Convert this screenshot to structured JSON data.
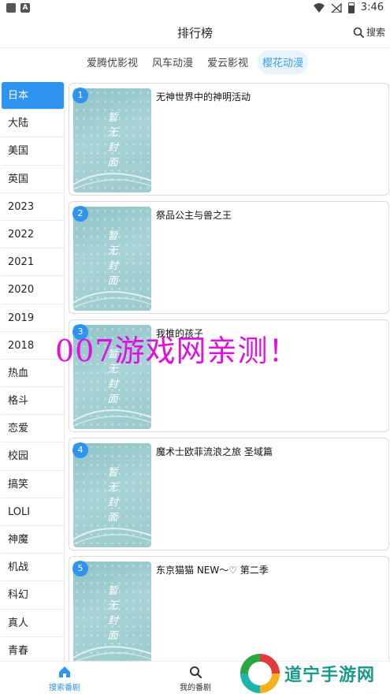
{
  "status_bar": {
    "time": "3:46",
    "left_badge": "A"
  },
  "header": {
    "title": "排行榜",
    "search_label": "搜索"
  },
  "sources": [
    {
      "label": "爱腾优影视",
      "active": false
    },
    {
      "label": "风车动漫",
      "active": false
    },
    {
      "label": "爱云影视",
      "active": false
    },
    {
      "label": "樱花动漫",
      "active": true
    }
  ],
  "sidebar": {
    "items": [
      "日本",
      "大陆",
      "美国",
      "英国",
      "2023",
      "2022",
      "2021",
      "2020",
      "2019",
      "2018",
      "热血",
      "格斗",
      "恋爱",
      "校园",
      "搞笑",
      "LOLI",
      "神魔",
      "机战",
      "科幻",
      "真人",
      "青春"
    ],
    "active_index": 0
  },
  "cards": [
    {
      "rank": "1",
      "title": "无神世界中的神明活动",
      "cover_text": "暂无封面"
    },
    {
      "rank": "2",
      "title": "祭品公主与兽之王",
      "cover_text": "暂无封面"
    },
    {
      "rank": "3",
      "title": "我推的孩子",
      "cover_text": "暂无封面"
    },
    {
      "rank": "4",
      "title": "魔术士欧菲流浪之旅 圣域篇",
      "cover_text": "暂无封面"
    },
    {
      "rank": "5",
      "title": "东京猫猫 NEW～♡ 第二季",
      "cover_text": "暂无封面"
    }
  ],
  "watermark": "007游戏网亲测！",
  "bottom_nav": {
    "search_tab": "搜索番剧",
    "mine_tab": "我的番剧"
  },
  "site_logo": {
    "text": "道宁手游网"
  },
  "colors": {
    "accent": "#2f94f0",
    "source_active_bg": "#e8f3fb",
    "watermark": "#e010e0"
  }
}
